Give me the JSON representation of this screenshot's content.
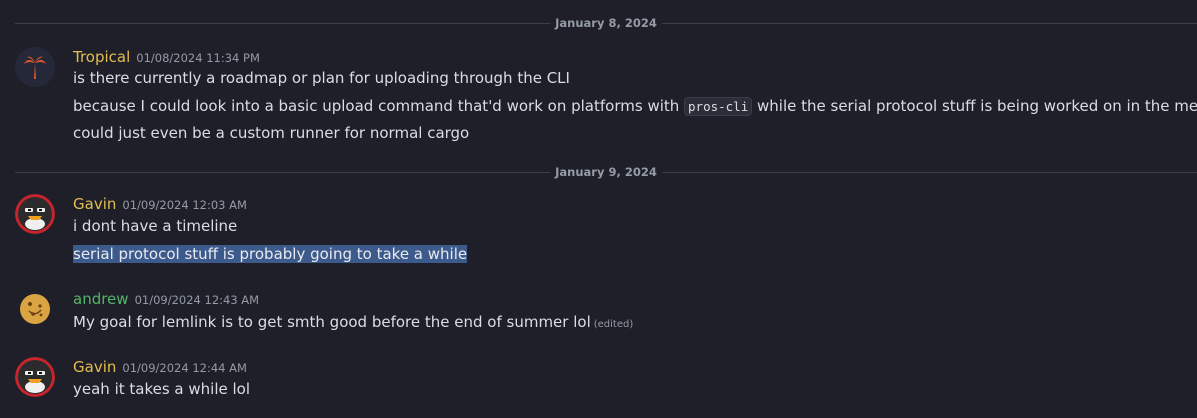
{
  "dividers": [
    {
      "label": "January 8, 2024"
    },
    {
      "label": "January 9, 2024"
    }
  ],
  "messages": [
    {
      "author": "Tropical",
      "author_color": "#e3bd4f",
      "timestamp": "01/08/2024 11:34 PM",
      "avatar": "palm-tree-icon",
      "lines": [
        "is there currently a roadmap or plan for uploading through the CLI",
        {
          "before": "because I could look into a basic upload command that'd work on platforms with ",
          "code": "pros-cli",
          "after": " while the serial protocol stuff is being worked on in the meantime"
        },
        "could just even be a custom runner for normal cargo"
      ]
    },
    {
      "author": "Gavin",
      "author_color": "#e3bd4f",
      "timestamp": "01/09/2024 12:03 AM",
      "avatar": "penguin-icon",
      "lines": [
        "i dont have a timeline",
        "serial protocol stuff is probably going to take a while"
      ]
    },
    {
      "author": "andrew",
      "author_color": "#55b567",
      "timestamp": "01/09/2024 12:43 AM",
      "avatar": "cookie-icon",
      "lines": [
        "My goal for lemlink is to get smth good before the end of summer lol"
      ],
      "edited_label": "(edited)"
    },
    {
      "author": "Gavin",
      "author_color": "#e3bd4f",
      "timestamp": "01/09/2024 12:44 AM",
      "avatar": "penguin-icon",
      "lines": [
        "yeah it takes a while lol"
      ]
    }
  ]
}
